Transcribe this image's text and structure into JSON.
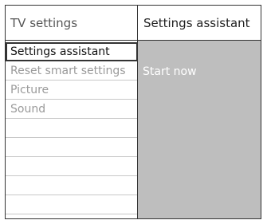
{
  "header": {
    "left_title": "TV settings",
    "right_title": "Settings assistant"
  },
  "menu": {
    "items": [
      {
        "label": "Settings assistant",
        "selected": true
      },
      {
        "label": "Reset smart settings",
        "selected": false
      },
      {
        "label": "Picture",
        "selected": false
      },
      {
        "label": "Sound",
        "selected": false
      },
      {
        "label": "",
        "selected": false
      },
      {
        "label": "",
        "selected": false
      },
      {
        "label": "",
        "selected": false
      },
      {
        "label": "",
        "selected": false
      },
      {
        "label": "",
        "selected": false
      }
    ]
  },
  "panel": {
    "option_label": "Start now"
  },
  "colors": {
    "panel_background": "#bebebe",
    "border": "#333333",
    "inactive_text": "#9a9a9a"
  }
}
